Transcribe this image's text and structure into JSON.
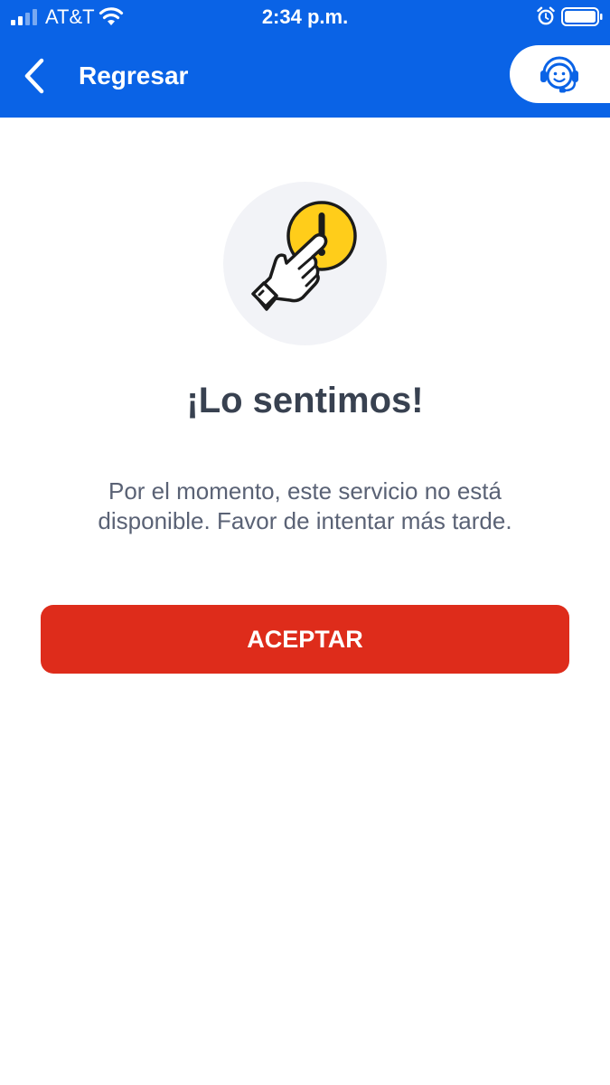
{
  "status_bar": {
    "carrier": "AT&T",
    "time": "2:34 p.m.",
    "icons": [
      "signal-icon",
      "wifi-icon",
      "alarm-icon",
      "battery-icon"
    ]
  },
  "header": {
    "back_label": "Regresar",
    "back_icon": "chevron-left-icon",
    "support_icon": "customer-support-icon"
  },
  "dialog": {
    "illustration_icon": "hand-warning-icon",
    "title": "¡Lo sentimos!",
    "message": "Por el momento, este servicio no está disponible. Favor de intentar más tarde.",
    "accept_label": "ACEPTAR"
  },
  "colors": {
    "header_blue": "#0a63e6",
    "accept_red": "#de2c1b",
    "warning_yellow": "#ffcd1a",
    "title_text": "#384150",
    "body_text": "#5a6275",
    "illustration_bg": "#f2f3f7"
  }
}
